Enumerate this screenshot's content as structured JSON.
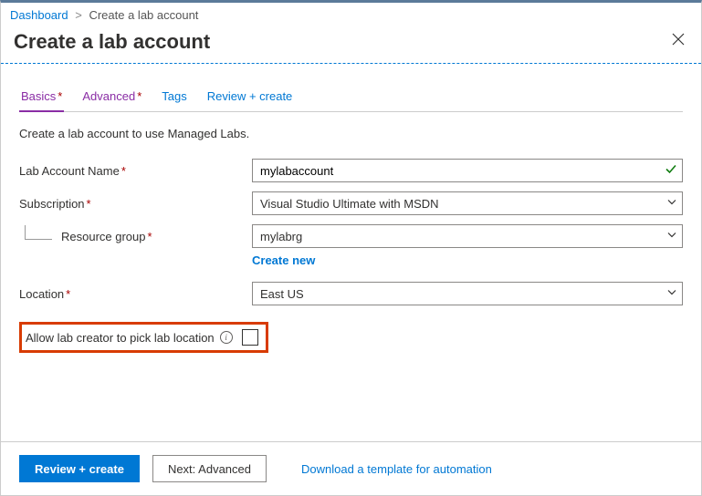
{
  "breadcrumb": {
    "root": "Dashboard",
    "current": "Create a lab account"
  },
  "page_title": "Create a lab account",
  "tabs": {
    "basics": "Basics",
    "advanced": "Advanced",
    "tags": "Tags",
    "review": "Review + create"
  },
  "description": "Create a lab account to use Managed Labs.",
  "form": {
    "lab_account_name": {
      "label": "Lab Account Name",
      "value": "mylabaccount"
    },
    "subscription": {
      "label": "Subscription",
      "value": "Visual Studio Ultimate with MSDN"
    },
    "resource_group": {
      "label": "Resource group",
      "value": "mylabrg",
      "create_new": "Create new"
    },
    "location": {
      "label": "Location",
      "value": "East US"
    },
    "allow_pick_location": {
      "label": "Allow lab creator to pick lab location"
    }
  },
  "footer": {
    "review": "Review + create",
    "next": "Next: Advanced",
    "template_link": "Download a template for automation"
  }
}
